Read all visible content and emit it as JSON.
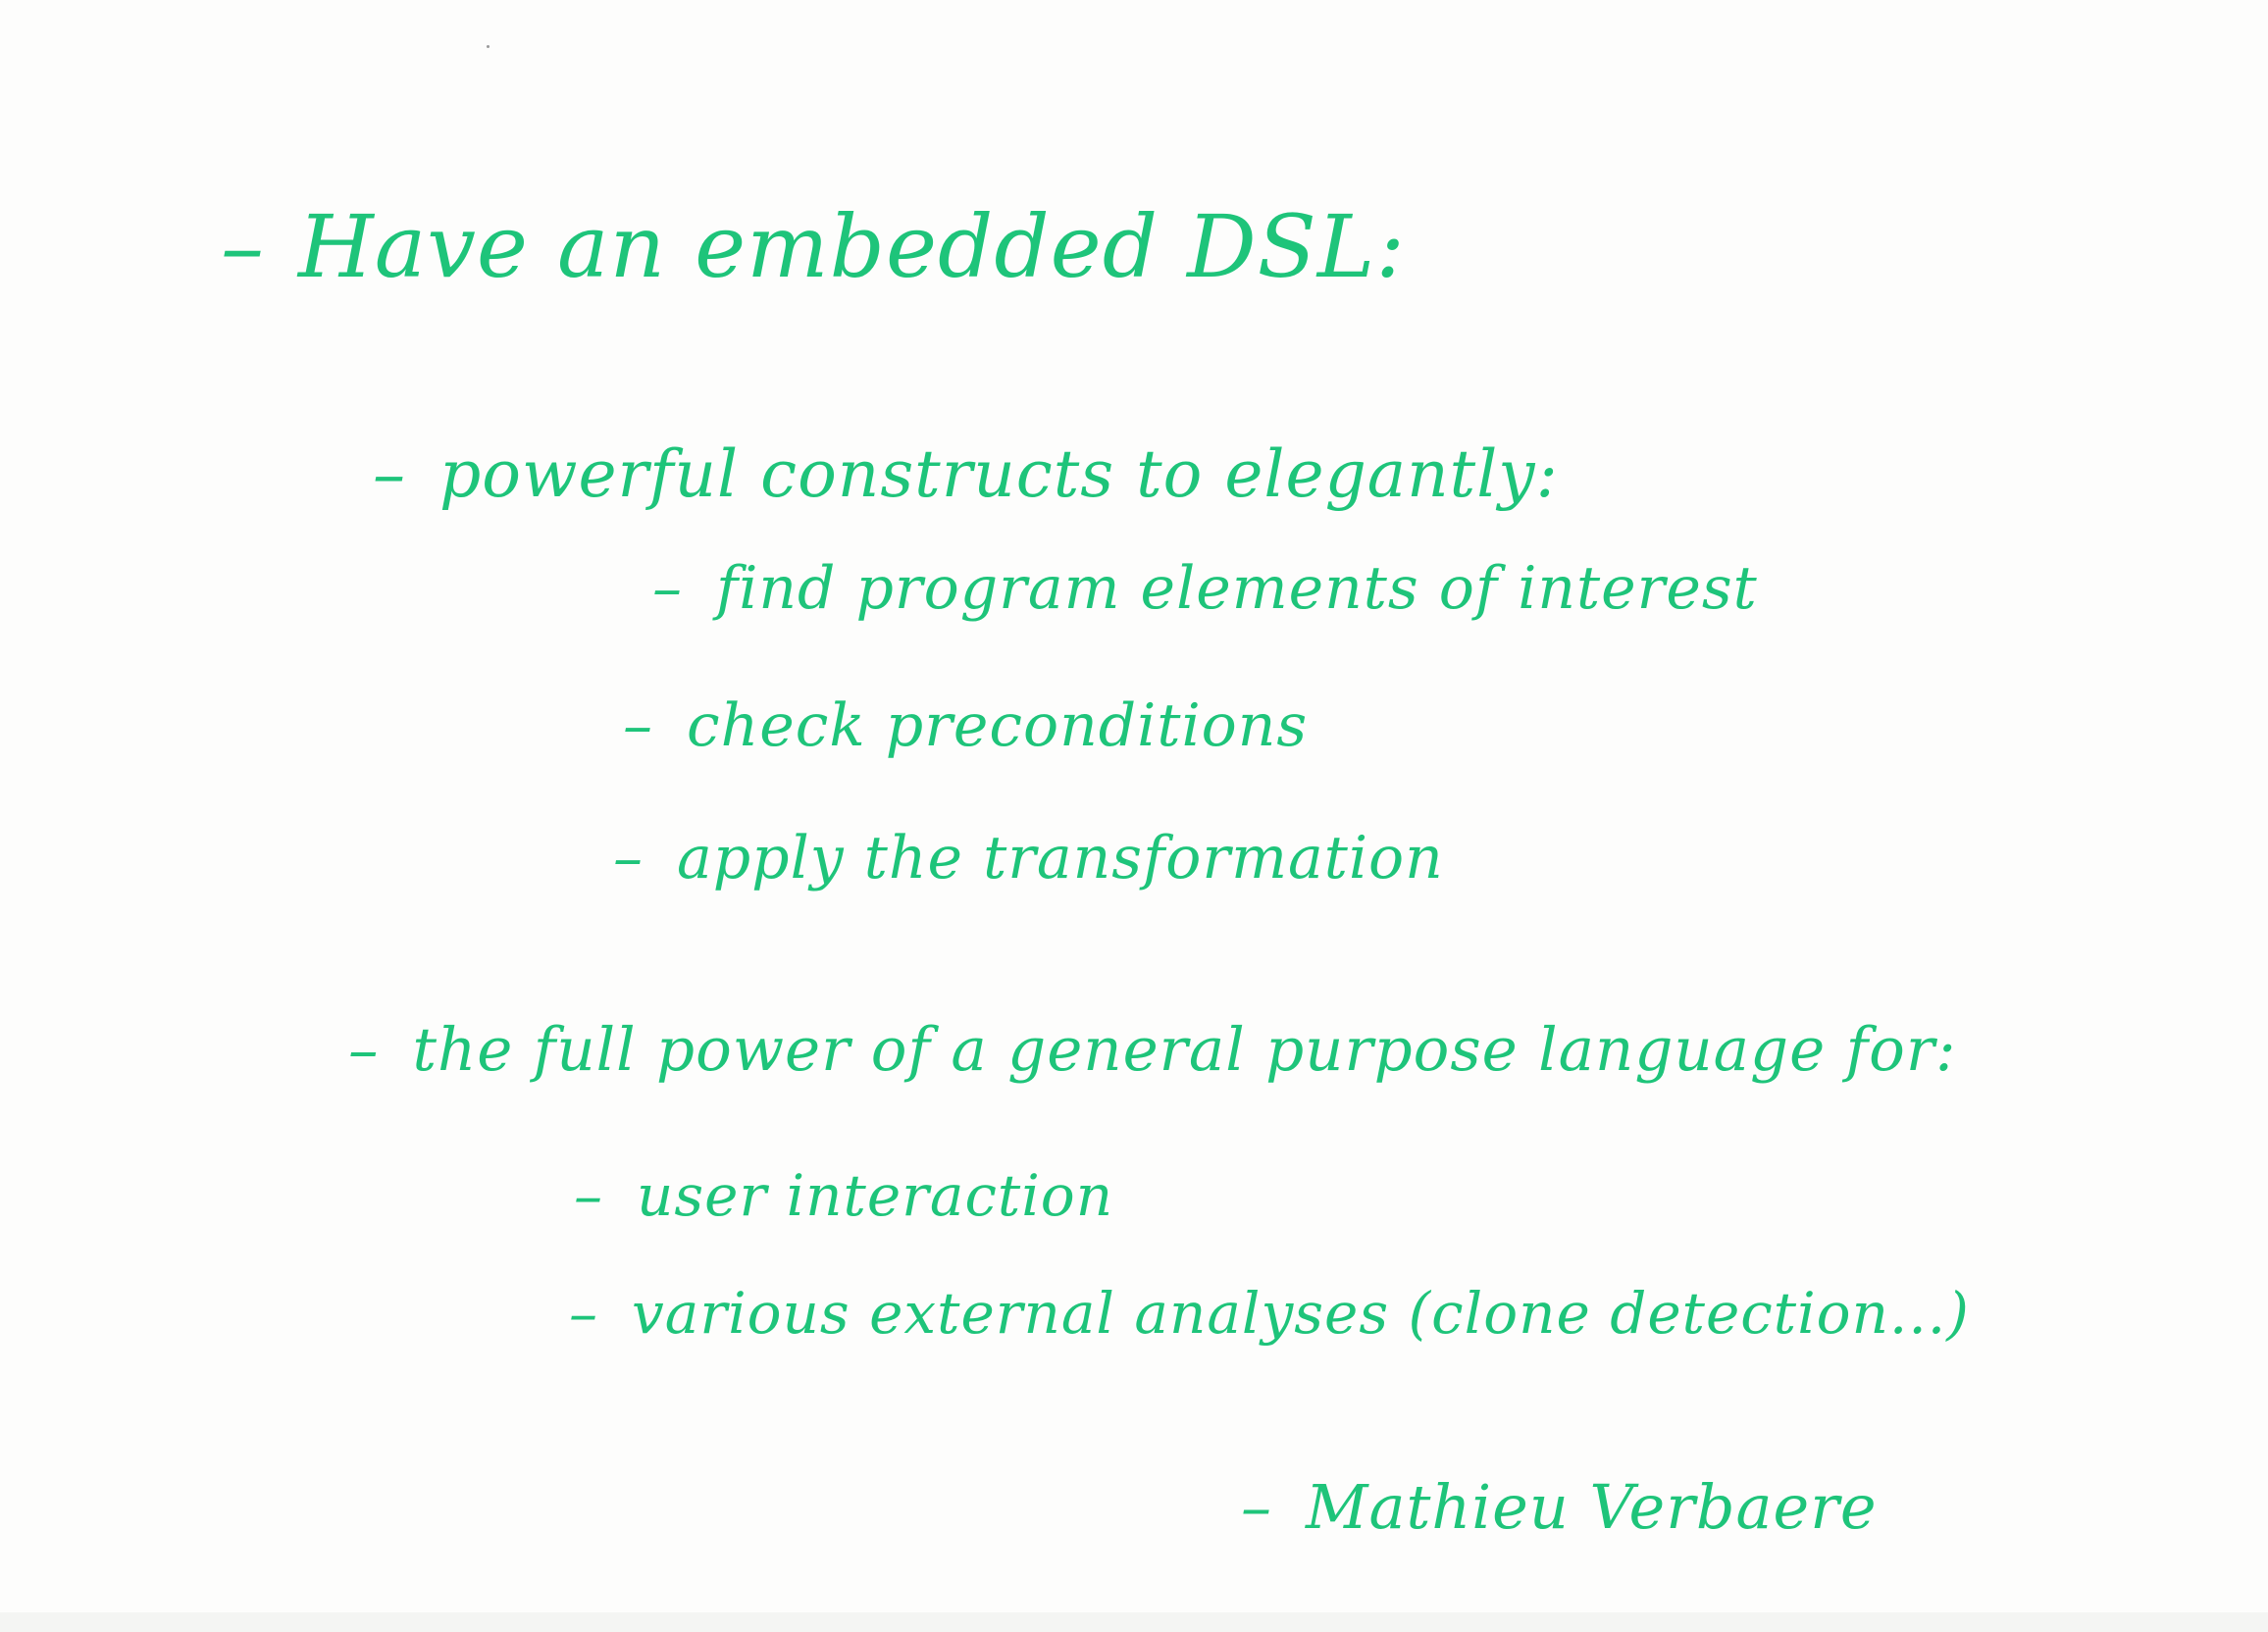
{
  "note": {
    "ink_color": "#1ec47a",
    "paper_color": "#fdfdfc",
    "heading": "Have an embedded DSL:",
    "section1": {
      "title": "powerful constructs to elegantly:",
      "items": [
        "find program elements of interest",
        "check preconditions",
        "apply the transformation"
      ]
    },
    "section2": {
      "title": "the full power of a general purpose language for:",
      "items": [
        "user interaction",
        "various external analyses (clone detection...)"
      ]
    },
    "signature": "Mathieu Verbaere",
    "bullet": "–"
  }
}
